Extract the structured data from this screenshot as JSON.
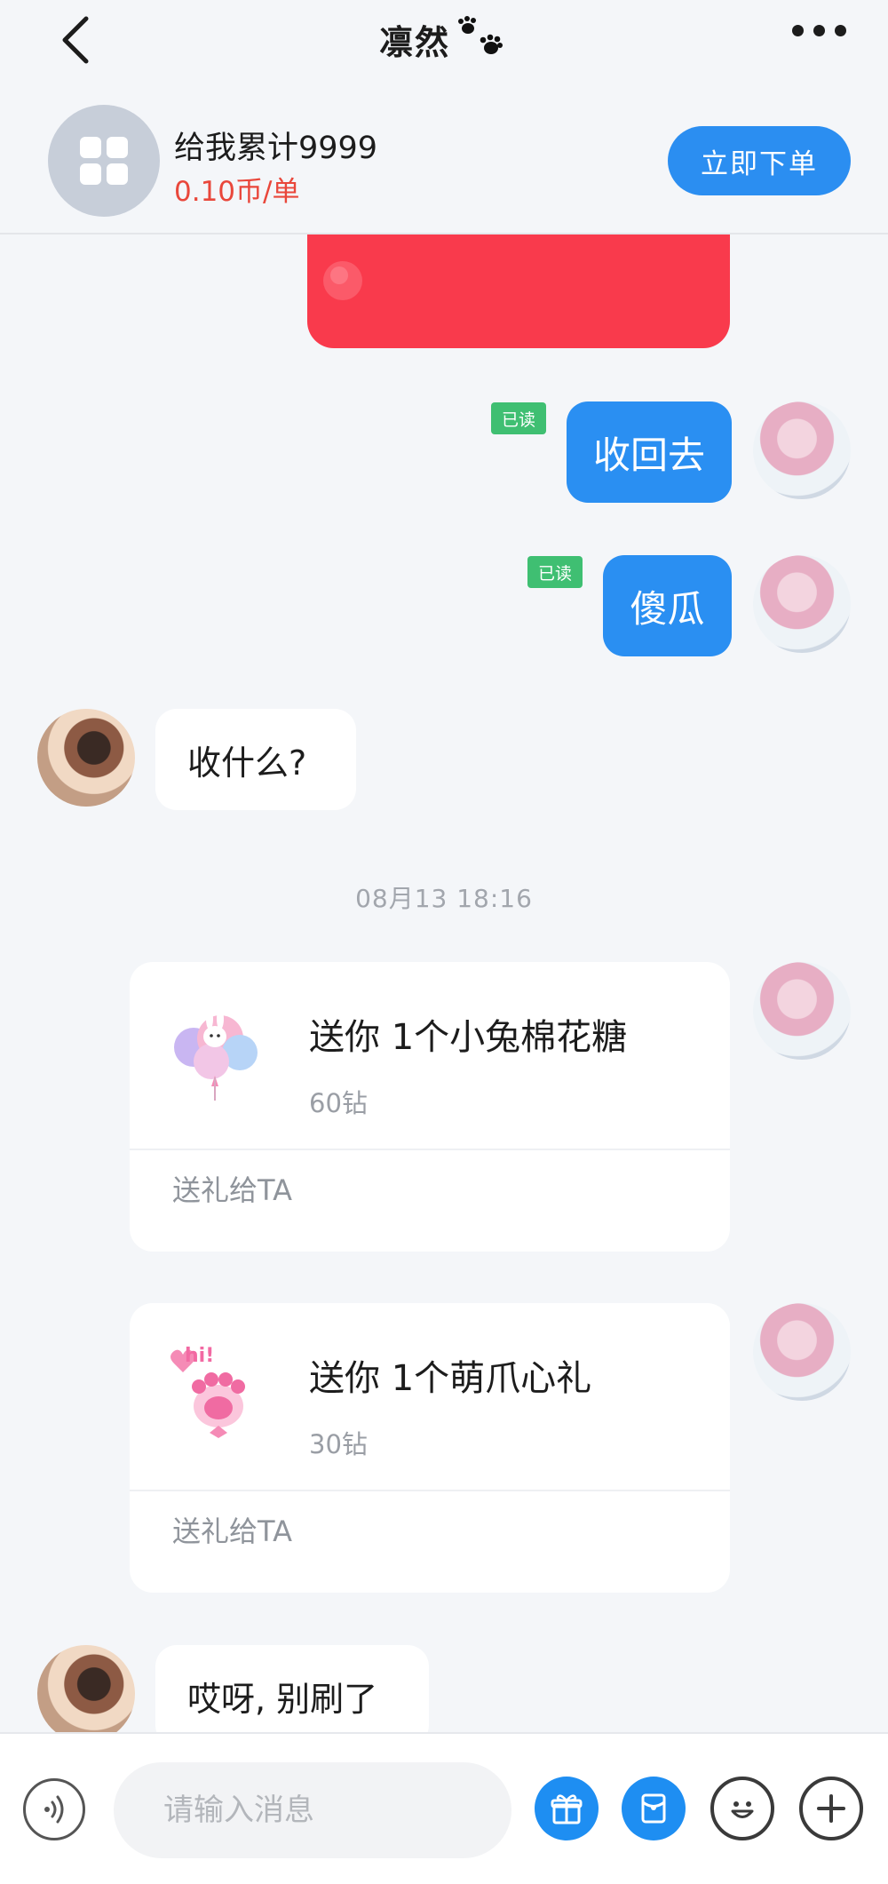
{
  "header": {
    "title": "凛然",
    "title_icon": "paw-prints-icon"
  },
  "service": {
    "name": "给我累计9999",
    "price": "0.10币/单",
    "order_label": "立即下单"
  },
  "messages": {
    "m1": {
      "text": "收回去",
      "read": "已读"
    },
    "m2": {
      "text": "傻瓜",
      "read": "已读"
    },
    "m3": {
      "text": "收什么?"
    },
    "timestamp": "08月13 18:16",
    "gift1": {
      "title": "送你 1个小兔棉花糖",
      "price": "60钻",
      "action": "送礼给TA"
    },
    "gift2": {
      "title": "送你 1个萌爪心礼",
      "price": "30钻",
      "action": "送礼给TA"
    },
    "m4": {
      "text": "哎呀, 别刷了"
    }
  },
  "input": {
    "placeholder": "请输入消息"
  },
  "colors": {
    "accent": "#2a8ff2",
    "price_red": "#e9473b",
    "read_green": "#3fbf72",
    "red_packet": "#f93a4c"
  }
}
